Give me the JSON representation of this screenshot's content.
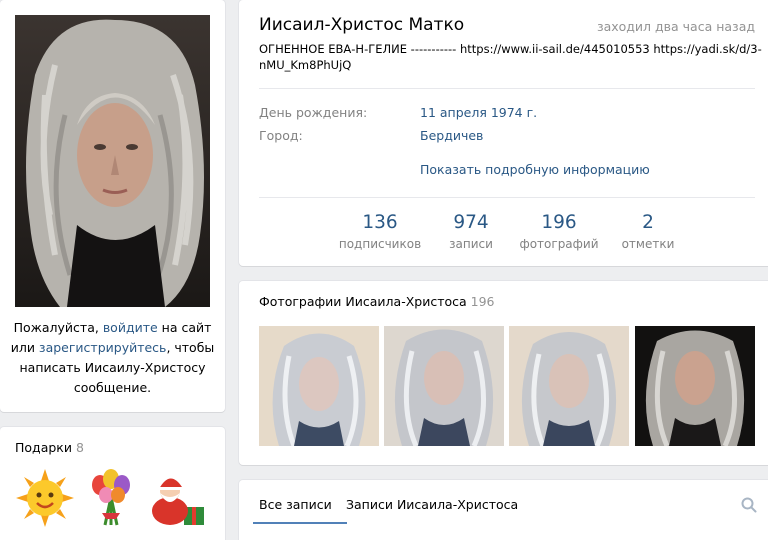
{
  "login_prompt": {
    "pre": "Пожалуйста, ",
    "login_link": "войдите",
    "mid": " на сайт или ",
    "register_link": "зарегистрируйтесь",
    "post": ", чтобы написать Иисаилу-Христосу сообщение."
  },
  "gifts": {
    "title": "Подарки",
    "count": "8",
    "items": [
      {
        "icon": "sun-icon"
      },
      {
        "icon": "tulips-icon"
      },
      {
        "icon": "santa-icon"
      }
    ]
  },
  "profile": {
    "name": "Иисаил-Христос Матко",
    "online": "заходил два часа назад",
    "status": "ОГНЕННОЕ ЕВА-Н-ГЕЛИЕ ----------- https://www.ii-sail.de/445010553 https://yadi.sk/d/3-nMU_Km8PhUjQ",
    "birthday_label": "День рождения:",
    "birthday_value": "11 апреля 1974 г.",
    "city_label": "Город:",
    "city_value": "Бердичев",
    "more_info": "Показать подробную информацию"
  },
  "counters": [
    {
      "value": "136",
      "label": "подписчиков"
    },
    {
      "value": "974",
      "label": "записи"
    },
    {
      "value": "196",
      "label": "фотографий"
    },
    {
      "value": "2",
      "label": "отметки"
    }
  ],
  "photos": {
    "title": "Фотографии Иисаила-Христоса",
    "count": "196"
  },
  "wall": {
    "tab_all": "Все записи",
    "tab_owner": "Записи Иисаила-Христоса"
  },
  "colors": {
    "link": "#2a5885",
    "accent": "#5181b8",
    "background": "#edeef0"
  }
}
